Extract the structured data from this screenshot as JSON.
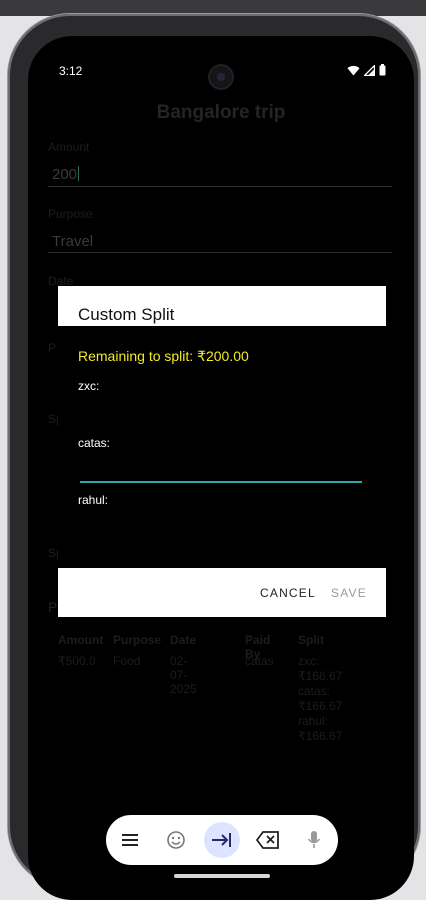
{
  "status_bar": {
    "time": "3:12"
  },
  "page": {
    "title": "Bangalore trip",
    "fields": [
      {
        "label": "Amount",
        "value": "200"
      },
      {
        "label": "Purpose",
        "value": "Travel"
      },
      {
        "label": "Date"
      },
      {
        "label": "P"
      },
      {
        "label": "Sp"
      },
      {
        "label": "Sp"
      },
      {
        "label": "P"
      }
    ]
  },
  "table": {
    "headers": [
      "Amount",
      "Purpose",
      "Date",
      "Paid By",
      "Split"
    ],
    "row": {
      "amount": "₹500.0",
      "purpose": "Food",
      "date": "02-07-2025",
      "paid_by": "catas",
      "split": [
        "zxc: ₹166.67",
        "catas: ₹166.67",
        "rahul: ₹166.67"
      ]
    }
  },
  "dialog": {
    "title": "Custom Split",
    "remaining": "Remaining to split: ₹200.00",
    "people": [
      {
        "label": "zxc:",
        "value": ""
      },
      {
        "label": "catas:",
        "value": ""
      },
      {
        "label": "rahul:",
        "value": ""
      }
    ],
    "cancel_label": "CANCEL",
    "save_label": "SAVE"
  },
  "keyboard": {
    "keys": [
      "menu-icon",
      "emoji-icon",
      "tab-arrow-icon",
      "backspace-icon",
      "mic-icon"
    ]
  },
  "colors": {
    "remaining_text": "#f2ea2a",
    "focused_underline": "#2aa6b3",
    "keyboard_active": "#dce4ff"
  }
}
